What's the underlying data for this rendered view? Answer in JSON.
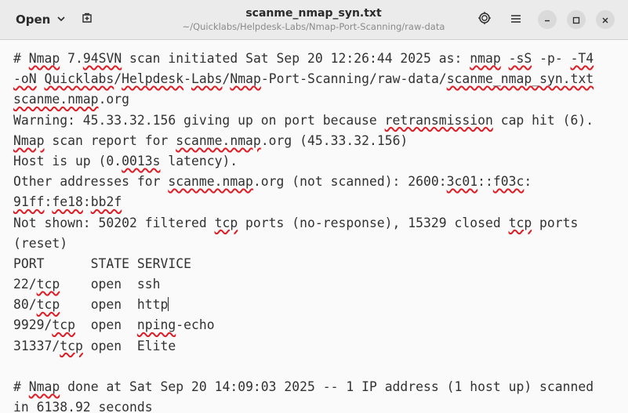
{
  "header": {
    "open_label": "Open",
    "title": "scanme_nmap_syn.txt",
    "subtitle": "~/Quicklabs/Helpdesk-Labs/Nmap-Port-Scanning/raw-data",
    "icons": {
      "open_menu": "chevron-down-icon",
      "new_document": "new-tab-icon",
      "highlight_mode": "sun-icon",
      "main_menu": "hamburger-icon",
      "minimize": "minimize-icon",
      "maximize": "maximize-icon",
      "close": "close-icon"
    }
  },
  "editor": {
    "spellcheck_color": "#e01b24",
    "lines": [
      [
        {
          "t": "# "
        },
        {
          "t": "Nmap",
          "s": 1
        },
        {
          "t": " 7."
        },
        {
          "t": "94SVN",
          "s": 1
        },
        {
          "t": " scan initiated Sat Sep 20 12:26:44 2025 as: "
        },
        {
          "t": "nmap",
          "s": 1
        },
        {
          "t": " "
        },
        {
          "t": "-sS",
          "s": 1
        },
        {
          "t": " -p- "
        },
        {
          "t": "-T4",
          "s": 1
        }
      ],
      [
        {
          "t": "-oN",
          "s": 1
        },
        {
          "t": " "
        },
        {
          "t": "Quicklabs",
          "s": 1
        },
        {
          "t": "/"
        },
        {
          "t": "Helpdesk",
          "s": 1
        },
        {
          "t": "-"
        },
        {
          "t": "Labs",
          "s": 1
        },
        {
          "t": "/"
        },
        {
          "t": "Nmap",
          "s": 1
        },
        {
          "t": "-Port-Scanning/raw-data/"
        },
        {
          "t": "scanme_nmap_syn.txt",
          "s": 1
        }
      ],
      [
        {
          "t": "scanme.nmap",
          "s": 1
        },
        {
          "t": ".org"
        }
      ],
      [
        {
          "t": "Warning: 45.33.32.156 giving up on port because "
        },
        {
          "t": "retransmission",
          "s": 1
        },
        {
          "t": " cap hit (6)."
        }
      ],
      [
        {
          "t": "Nmap",
          "s": 1
        },
        {
          "t": " scan report for "
        },
        {
          "t": "scanme.nmap",
          "s": 1
        },
        {
          "t": ".org (45.33.32.156)"
        }
      ],
      [
        {
          "t": "Host is up (0."
        },
        {
          "t": "0013s",
          "s": 1
        },
        {
          "t": " latency)."
        }
      ],
      [
        {
          "t": "Other addresses for "
        },
        {
          "t": "scanme.nmap",
          "s": 1
        },
        {
          "t": ".org (not scanned): 2600:"
        },
        {
          "t": "3c01",
          "s": 1
        },
        {
          "t": "::"
        },
        {
          "t": "f03c",
          "s": 1
        },
        {
          "t": ":"
        }
      ],
      [
        {
          "t": "91ff",
          "s": 1
        },
        {
          "t": ":"
        },
        {
          "t": "fe18",
          "s": 1
        },
        {
          "t": ":"
        },
        {
          "t": "bb2f",
          "s": 1
        }
      ],
      [
        {
          "t": "Not shown: 50202 filtered "
        },
        {
          "t": "tcp",
          "s": 1
        },
        {
          "t": " ports (no-response), 15329 closed "
        },
        {
          "t": "tcp",
          "s": 1
        },
        {
          "t": " ports"
        }
      ],
      [
        {
          "t": "(reset)"
        }
      ],
      [
        {
          "t": "PORT      STATE SERVICE"
        }
      ],
      [
        {
          "t": "22/"
        },
        {
          "t": "tcp",
          "s": 1
        },
        {
          "t": "    open  ssh"
        }
      ],
      [
        {
          "t": "80/"
        },
        {
          "t": "tcp",
          "s": 1
        },
        {
          "t": "    open  http"
        },
        {
          "cursor": 1
        }
      ],
      [
        {
          "t": "9929/"
        },
        {
          "t": "tcp",
          "s": 1
        },
        {
          "t": "  open  "
        },
        {
          "t": "nping",
          "s": 1
        },
        {
          "t": "-echo"
        }
      ],
      [
        {
          "t": "31337/"
        },
        {
          "t": "tcp",
          "s": 1
        },
        {
          "t": " open  Elite"
        }
      ],
      [],
      [
        {
          "t": "# "
        },
        {
          "t": "Nmap",
          "s": 1
        },
        {
          "t": " done at Sat Sep 20 14:09:03 2025 -- 1 IP address (1 host up) scanned"
        }
      ],
      [
        {
          "t": "in 6138.92 seconds"
        }
      ]
    ]
  }
}
